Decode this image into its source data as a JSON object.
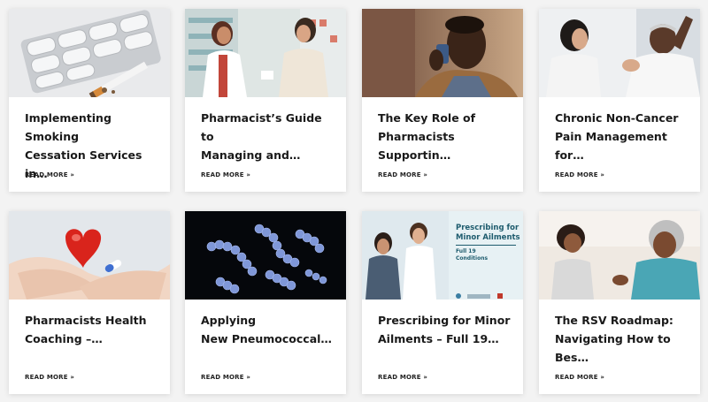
{
  "cards": [
    {
      "title": "Implementing Smoking\nCessation Services in…",
      "read_more": "READ MORE »",
      "image": "nicotine-gum-cigarette"
    },
    {
      "title": "Pharmacist’s Guide to\nManaging and…",
      "read_more": "READ MORE »",
      "image": "pharmacist-counter"
    },
    {
      "title": "The Key Role of\nPharmacists Supportin…",
      "read_more": "READ MORE »",
      "image": "man-inhaler"
    },
    {
      "title": "Chronic Non-Cancer\nPain Management for…",
      "read_more": "READ MORE »",
      "image": "elderly-pain"
    },
    {
      "title": "Pharmacists Health\nCoaching –…",
      "read_more": "READ MORE »",
      "image": "heart-in-hands"
    },
    {
      "title": "Applying\nNew Pneumococcal…",
      "read_more": "READ MORE »",
      "image": "bacteria"
    },
    {
      "title": "Prescribing for Minor\nAilments – Full 19…",
      "read_more": "READ MORE »",
      "image": "minor-ailments-banner"
    },
    {
      "title": "The RSV Roadmap:\nNavigating How to Bes…",
      "read_more": "READ MORE »",
      "image": "grandmother-child"
    }
  ],
  "banner": {
    "heading": "Prescribing for\nMinor Ailments",
    "sub": "Full 19\nConditions"
  }
}
